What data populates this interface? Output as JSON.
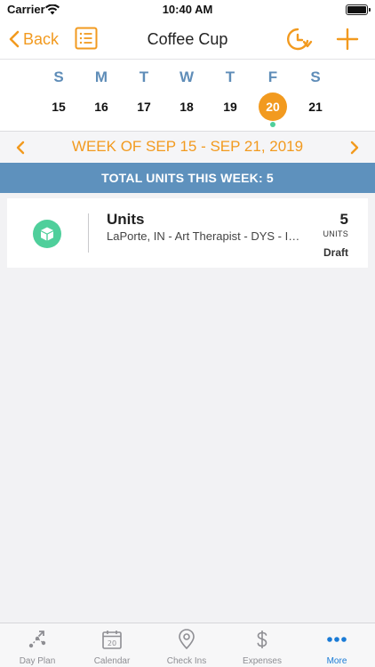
{
  "status_bar": {
    "carrier": "Carrier",
    "time": "10:40 AM"
  },
  "nav": {
    "back_label": "Back",
    "title": "Coffee Cup"
  },
  "week": {
    "days": [
      {
        "letter": "S",
        "date": "15"
      },
      {
        "letter": "M",
        "date": "16"
      },
      {
        "letter": "T",
        "date": "17"
      },
      {
        "letter": "W",
        "date": "18"
      },
      {
        "letter": "T",
        "date": "19"
      },
      {
        "letter": "F",
        "date": "20"
      },
      {
        "letter": "S",
        "date": "21"
      }
    ],
    "selected_index": 5,
    "range_label": "WEEK OF SEP 15 - SEP 21, 2019"
  },
  "summary": {
    "total_label": "TOTAL UNITS THIS WEEK: 5"
  },
  "entries": [
    {
      "title": "Units",
      "subtitle": "LaPorte, IN - Art Therapist - DYS - Individual",
      "count": "5",
      "count_unit": "UNITS",
      "status": "Draft"
    }
  ],
  "tabs": [
    {
      "label": "Day Plan",
      "icon": "route-icon"
    },
    {
      "label": "Calendar",
      "icon": "calendar-icon",
      "icon_text": "20"
    },
    {
      "label": "Check Ins",
      "icon": "location-pin-icon"
    },
    {
      "label": "Expenses",
      "icon": "dollar-icon"
    },
    {
      "label": "More",
      "icon": "more-dots-icon"
    }
  ],
  "active_tab": 4,
  "colors": {
    "accent": "#f29a1f",
    "header_blue": "#5e91bd",
    "green": "#4fcf9b",
    "tab_active": "#1a7bd6"
  }
}
